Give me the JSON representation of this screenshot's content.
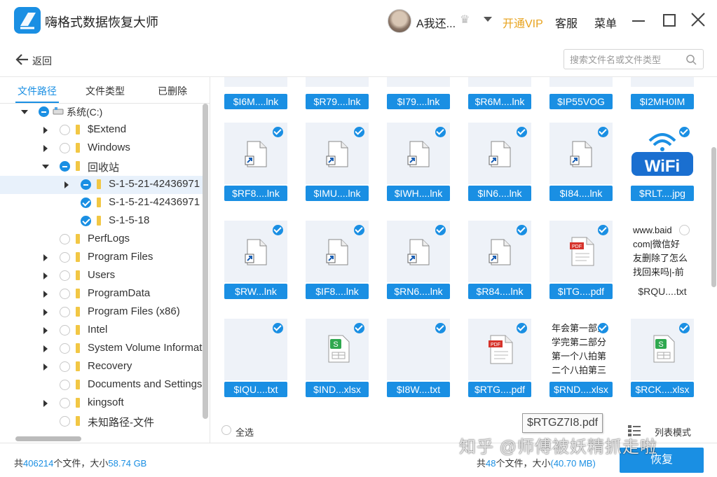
{
  "app": {
    "title": "嗨格式数据恢复大师",
    "username": "A我还...",
    "vip_label": "开通VIP",
    "service_label": "客服",
    "menu_label": "菜单"
  },
  "nav": {
    "back_label": "返回",
    "search_placeholder": "搜索文件名或文件类型"
  },
  "tabs": [
    "文件路径",
    "文件类型",
    "已删除"
  ],
  "tree": [
    {
      "label": "系统(C:)",
      "state": "partial",
      "expander": "open",
      "depth": 0,
      "icon": "drive"
    },
    {
      "label": "$Extend",
      "state": "none",
      "expander": "closed",
      "depth": 1
    },
    {
      "label": "Windows",
      "state": "none",
      "expander": "closed",
      "depth": 1
    },
    {
      "label": "回收站",
      "state": "partial",
      "expander": "open",
      "depth": 1
    },
    {
      "label": "S-1-5-21-42436971",
      "state": "partial",
      "expander": "closed",
      "depth": 2,
      "selected": true
    },
    {
      "label": "S-1-5-21-42436971",
      "state": "checked",
      "expander": "none",
      "depth": 2
    },
    {
      "label": "S-1-5-18",
      "state": "checked",
      "expander": "none",
      "depth": 2
    },
    {
      "label": "PerfLogs",
      "state": "none",
      "expander": "none",
      "depth": 1
    },
    {
      "label": "Program Files",
      "state": "none",
      "expander": "closed",
      "depth": 1
    },
    {
      "label": "Users",
      "state": "none",
      "expander": "closed",
      "depth": 1
    },
    {
      "label": "ProgramData",
      "state": "none",
      "expander": "closed",
      "depth": 1
    },
    {
      "label": "Program Files (x86)",
      "state": "none",
      "expander": "closed",
      "depth": 1
    },
    {
      "label": "Intel",
      "state": "none",
      "expander": "closed",
      "depth": 1
    },
    {
      "label": "System Volume Information",
      "state": "none",
      "expander": "closed",
      "depth": 1
    },
    {
      "label": "Recovery",
      "state": "none",
      "expander": "closed",
      "depth": 1
    },
    {
      "label": "Documents and Settings",
      "state": "none",
      "expander": "none",
      "depth": 1
    },
    {
      "label": "kingsoft",
      "state": "none",
      "expander": "closed",
      "depth": 1
    },
    {
      "label": "未知路径-文件",
      "state": "none",
      "expander": "none",
      "depth": 1
    }
  ],
  "files_top_row": [
    "$I6M....lnk",
    "$R79....lnk",
    "$I79....lnk",
    "$R6M....lnk",
    "$IP55VOG",
    "$I2MH0IM"
  ],
  "files": [
    {
      "name": "$RF8....lnk",
      "type": "lnk",
      "checked": true
    },
    {
      "name": "$IMU....lnk",
      "type": "lnk",
      "checked": true
    },
    {
      "name": "$IWH....lnk",
      "type": "lnk",
      "checked": true
    },
    {
      "name": "$IN6....lnk",
      "type": "lnk",
      "checked": true
    },
    {
      "name": "$I84....lnk",
      "type": "lnk",
      "checked": true
    },
    {
      "name": "$RLT....jpg",
      "type": "wifi",
      "checked": true
    },
    {
      "name": "$RW...lnk",
      "type": "lnk",
      "checked": true
    },
    {
      "name": "$IF8....lnk",
      "type": "lnk",
      "checked": true
    },
    {
      "name": "$RN6....lnk",
      "type": "lnk",
      "checked": true
    },
    {
      "name": "$R84....lnk",
      "type": "lnk",
      "checked": true
    },
    {
      "name": "$ITG....pdf",
      "type": "pdf",
      "checked": true
    },
    {
      "name": "$RQU....txt",
      "type": "txt",
      "checked": false,
      "plain": true,
      "preview": [
        "www.baid",
        "com|微信好",
        "友删除了怎么",
        "找回来吗|-前"
      ]
    },
    {
      "name": "$IQU....txt",
      "type": "blank",
      "checked": true
    },
    {
      "name": "$IND...xlsx",
      "type": "xlsx",
      "checked": true
    },
    {
      "name": "$I8W....txt",
      "type": "blank",
      "checked": true
    },
    {
      "name": "$RTG....pdf",
      "type": "pdf",
      "checked": true
    },
    {
      "name": "$RND....xlsx",
      "type": "txt",
      "checked": true,
      "preview": [
        "年会第一部分",
        "学完第二部分",
        "第一个八拍第",
        "二个八拍第三"
      ]
    },
    {
      "name": "$RCK....xlsx",
      "type": "xlsx",
      "checked": true
    }
  ],
  "wifi_text": "WiFi",
  "pdf_badge": "PDF",
  "xlsx_badge": "S",
  "footer": {
    "select_all": "全选",
    "tooltip": "$RTGZ7I8.pdf",
    "view_mode": "列表模式"
  },
  "status": {
    "left_prefix": "共",
    "left_count": "406214",
    "left_mid": "个文件，大小",
    "left_size": "58.74 GB",
    "right_prefix": "共",
    "right_count": "48",
    "right_mid": "个文件，大小",
    "right_size": "(40.70 MB)",
    "recover_label": "恢复"
  },
  "watermark": "知乎 @师傅被妖精抓走啦",
  "colors": {
    "accent": "#1a8fe3",
    "vip": "#e8a31e"
  }
}
